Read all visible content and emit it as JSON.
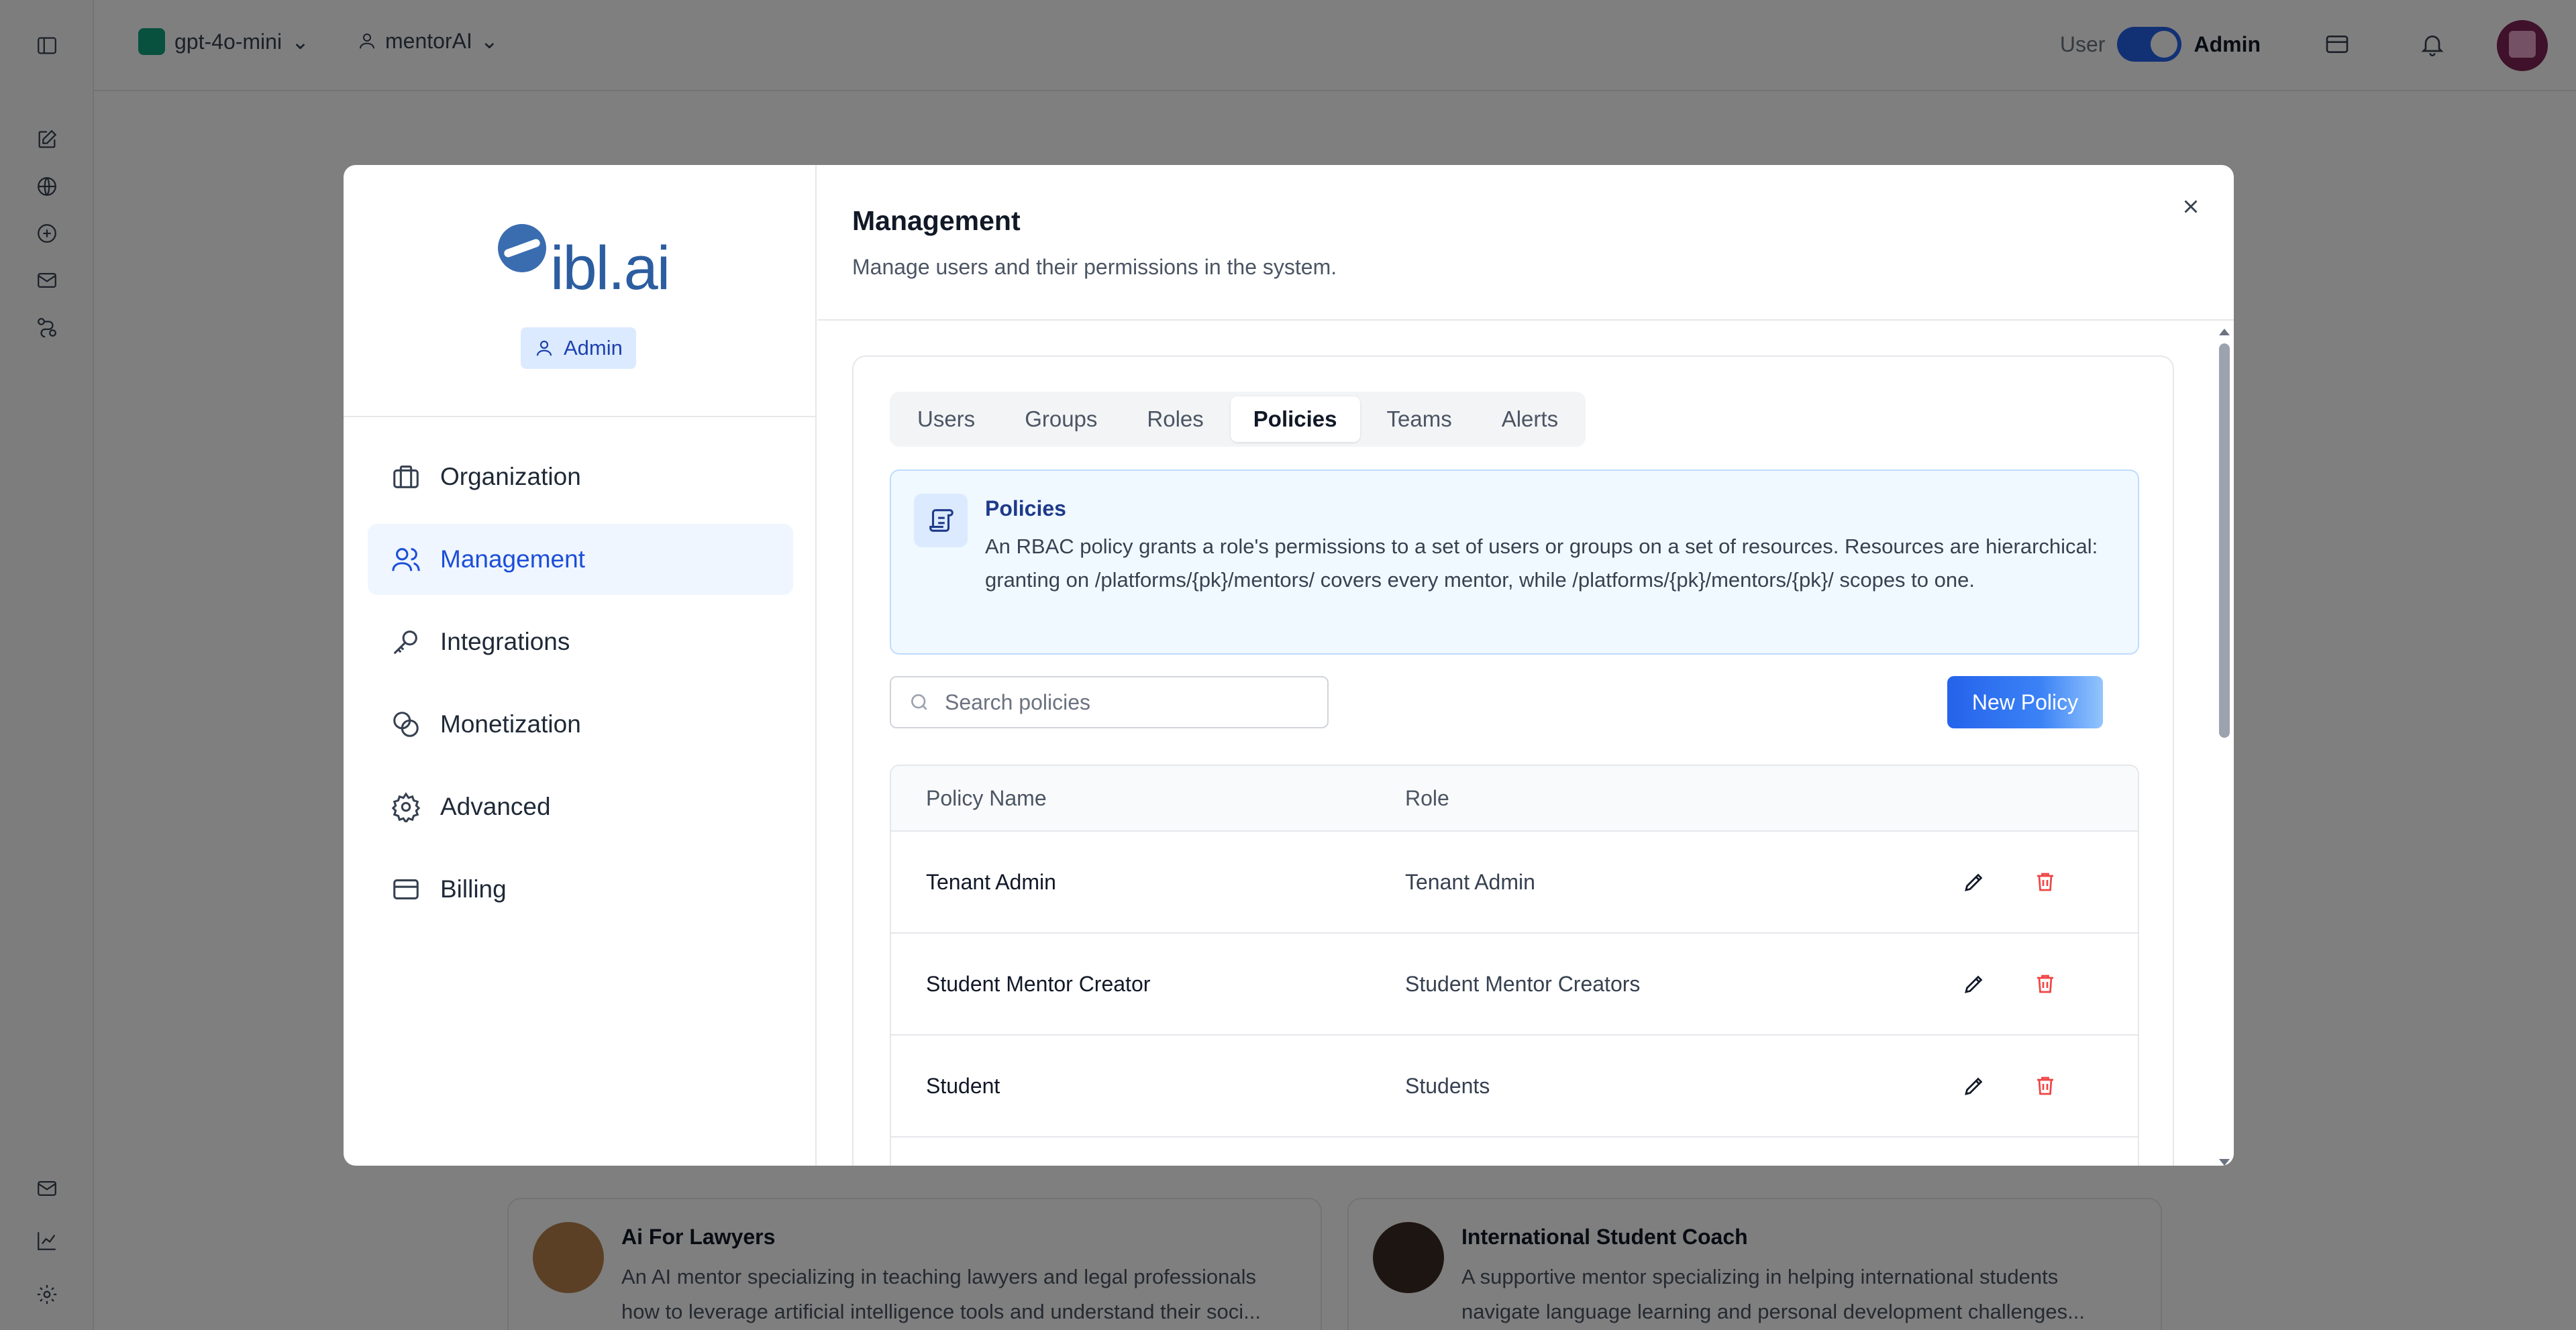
{
  "topbar": {
    "model": "gpt-4o-mini",
    "mentor": "mentorAI",
    "toggle_user": "User",
    "toggle_admin": "Admin"
  },
  "background_cards": [
    {
      "title": "Ai For Lawyers",
      "description": "An AI mentor specializing in teaching lawyers and legal professionals how to leverage artificial intelligence tools and understand their soci..."
    },
    {
      "title": "International Student Coach",
      "description": "A supportive mentor specializing in helping international students navigate language learning and personal development challenges..."
    }
  ],
  "modal": {
    "logo_text": "ibl.ai",
    "badge": "Admin",
    "nav": [
      {
        "label": "Organization",
        "icon": "briefcase-icon"
      },
      {
        "label": "Management",
        "icon": "users-icon"
      },
      {
        "label": "Integrations",
        "icon": "key-icon"
      },
      {
        "label": "Monetization",
        "icon": "coins-icon"
      },
      {
        "label": "Advanced",
        "icon": "gear-icon"
      },
      {
        "label": "Billing",
        "icon": "credit-card-icon"
      }
    ],
    "active_nav": "Management",
    "title": "Management",
    "subtitle": "Manage users and their permissions in the system.",
    "tabs": [
      "Users",
      "Groups",
      "Roles",
      "Policies",
      "Teams",
      "Alerts"
    ],
    "active_tab": "Policies",
    "info": {
      "title": "Policies",
      "text": "An RBAC policy grants a role's permissions to a set of users or groups on a set of resources. Resources are hierarchical: granting on /platforms/{pk}/mentors/ covers every mentor, while /platforms/{pk}/mentors/{pk}/ scopes to one."
    },
    "search_placeholder": "Search policies",
    "new_button": "New Policy",
    "table": {
      "headers": [
        "Policy Name",
        "Role"
      ],
      "rows": [
        {
          "name": "Tenant Admin",
          "role": "Tenant Admin"
        },
        {
          "name": "Student Mentor Creator",
          "role": "Student Mentor Creators"
        },
        {
          "name": "Student",
          "role": "Students"
        }
      ]
    }
  },
  "colors": {
    "accent": "#2563eb",
    "active_nav_bg": "#eff6ff",
    "delete": "#ef4444",
    "info_bg": "#f0f9ff"
  }
}
